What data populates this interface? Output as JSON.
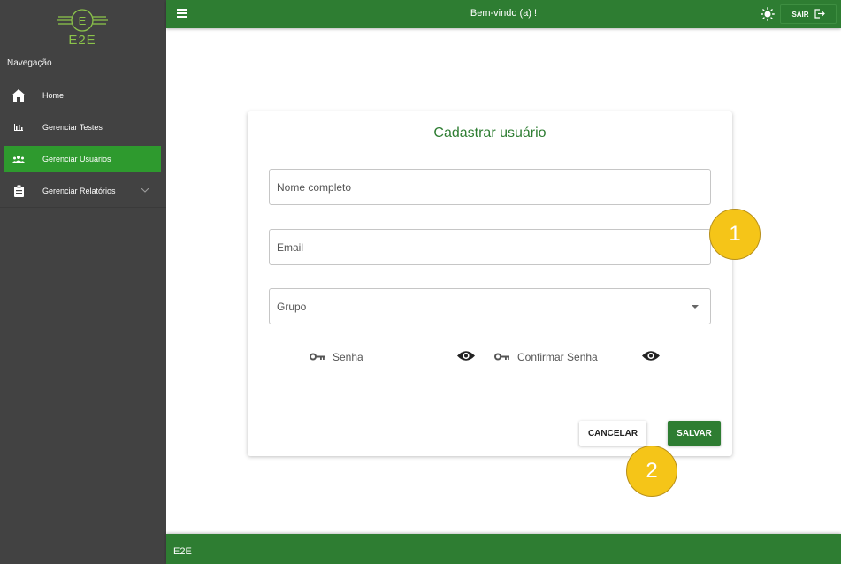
{
  "app": {
    "logo_letter": "E",
    "logo_text": "E2E"
  },
  "sidebar": {
    "heading": "Navegação",
    "items": [
      {
        "label": "Home",
        "icon": "home-icon"
      },
      {
        "label": "Gerenciar Testes",
        "icon": "bar-chart-icon"
      },
      {
        "label": "Gerenciar Usuários",
        "icon": "users-icon",
        "active": true
      },
      {
        "label": "Gerenciar Relatórios",
        "icon": "clipboard-icon",
        "expandable": true
      }
    ]
  },
  "topbar": {
    "title": "Bem-vindo (a) !",
    "logout_label": "SAIR"
  },
  "form": {
    "title": "Cadastrar usuário",
    "full_name_placeholder": "Nome completo",
    "email_placeholder": "Email",
    "group_placeholder": "Grupo",
    "password_placeholder": "Senha",
    "confirm_password_placeholder": "Confirmar Senha",
    "cancel_label": "CANCELAR",
    "save_label": "SALVAR"
  },
  "footer": {
    "text": "E2E"
  },
  "annotations": [
    {
      "number": "1"
    },
    {
      "number": "2"
    }
  ],
  "colors": {
    "primary": "#2e7d32",
    "active_nav": "#2e9a2e",
    "sidebar_bg": "#424242",
    "marker": "#f5c518",
    "logo": "#8bc34a"
  }
}
